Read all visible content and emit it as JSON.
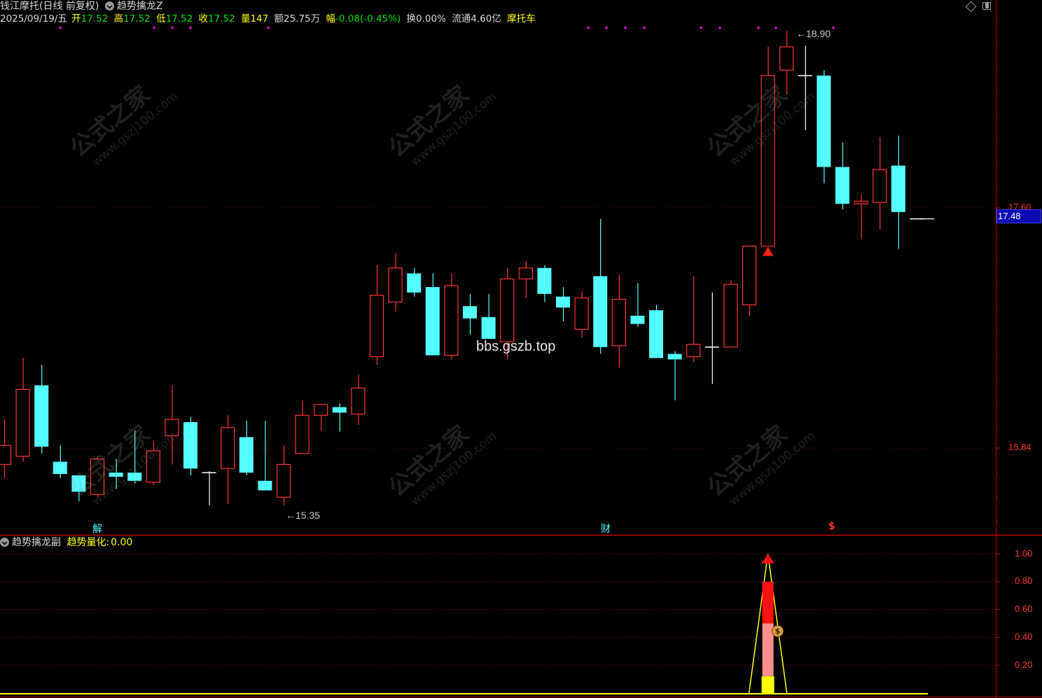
{
  "header": {
    "stock_name": "钱江摩托",
    "period": "(日线 前复权)",
    "indicator": "趋势擒龙Z",
    "date": "2025/09/19/五",
    "open_label": "开",
    "open": "17.52",
    "high_label": "高",
    "high": "17.52",
    "low_label": "低",
    "low": "17.52",
    "close_label": "收",
    "close": "17.52",
    "vol_label": "量",
    "vol": "147",
    "amount_label": "额",
    "amount": "25.75万",
    "change_label": "幅",
    "change": "-0.08(-0.45%)",
    "turnover_label": "换",
    "turnover": "0.00%",
    "float_label": "流通",
    "float_cap": "4.60亿",
    "sector": "摩托车"
  },
  "sub_header": {
    "panel_name": "趋势擒龙副",
    "series_label": "趋势量化:",
    "series_value": "0.00"
  },
  "annotations": {
    "high_marker": "18.90",
    "low_marker": "15.35",
    "signal_1": "解",
    "signal_2": "财",
    "signal_3": "$",
    "coin": "$",
    "watermark_site": "bbs.gszb.top",
    "watermark_logo": "公式之家",
    "watermark_url": "www.gszj100.com"
  },
  "price_axis": {
    "ticks": [
      "17.60",
      "15.84"
    ],
    "current_price": "17.48"
  },
  "sub_axis": {
    "ticks": [
      "1.00",
      "0.80",
      "0.60",
      "0.40",
      "0.20"
    ]
  },
  "toolbar": {
    "diamond_icon": "diamond-icon",
    "window_icon": "window-icon"
  },
  "colors": {
    "up": "#ff3232",
    "down": "#54ffff",
    "flat": "#ffffff",
    "axis": "#c00000",
    "yellow": "#ffff00",
    "magenta": "#ff00ff"
  },
  "chart_data": [
    {
      "type": "candlestick",
      "title": "钱江摩托(日线 前复权)",
      "ylim": [
        14.9,
        19.1
      ],
      "candles": [
        {
          "o": 15.72,
          "h": 16.05,
          "l": 15.62,
          "c": 15.86
        },
        {
          "o": 15.78,
          "h": 16.5,
          "l": 15.74,
          "c": 16.27
        },
        {
          "o": 16.3,
          "h": 16.45,
          "l": 15.8,
          "c": 15.85
        },
        {
          "o": 15.74,
          "h": 15.86,
          "l": 15.62,
          "c": 15.65
        },
        {
          "o": 15.64,
          "h": 15.63,
          "l": 15.45,
          "c": 15.52
        },
        {
          "o": 15.5,
          "h": 15.78,
          "l": 15.48,
          "c": 15.76
        },
        {
          "o": 15.66,
          "h": 15.76,
          "l": 15.54,
          "c": 15.63
        },
        {
          "o": 15.66,
          "h": 15.97,
          "l": 15.58,
          "c": 15.6
        },
        {
          "o": 15.59,
          "h": 15.89,
          "l": 15.57,
          "c": 15.82
        },
        {
          "o": 15.93,
          "h": 16.3,
          "l": 15.72,
          "c": 16.05
        },
        {
          "o": 16.03,
          "h": 16.07,
          "l": 15.64,
          "c": 15.69
        },
        {
          "o": 15.66,
          "h": 15.67,
          "l": 15.42,
          "c": 15.66
        },
        {
          "o": 15.69,
          "h": 16.08,
          "l": 15.43,
          "c": 15.99
        },
        {
          "o": 15.92,
          "h": 16.04,
          "l": 15.64,
          "c": 15.66
        },
        {
          "o": 15.6,
          "h": 16.04,
          "l": 15.58,
          "c": 15.53
        },
        {
          "o": 15.48,
          "h": 15.86,
          "l": 15.42,
          "c": 15.72
        },
        {
          "o": 15.8,
          "h": 16.19,
          "l": 15.81,
          "c": 16.08
        },
        {
          "o": 16.08,
          "h": 16.15,
          "l": 15.97,
          "c": 16.16
        },
        {
          "o": 16.14,
          "h": 16.17,
          "l": 15.96,
          "c": 16.1
        },
        {
          "o": 16.09,
          "h": 16.38,
          "l": 16.01,
          "c": 16.28
        },
        {
          "o": 16.51,
          "h": 17.18,
          "l": 16.45,
          "c": 16.96
        },
        {
          "o": 16.91,
          "h": 17.27,
          "l": 16.84,
          "c": 17.16
        },
        {
          "o": 17.12,
          "h": 17.16,
          "l": 16.95,
          "c": 16.98
        },
        {
          "o": 17.02,
          "h": 17.12,
          "l": 16.52,
          "c": 16.52
        },
        {
          "o": 16.52,
          "h": 17.12,
          "l": 16.49,
          "c": 17.03
        },
        {
          "o": 16.88,
          "h": 16.97,
          "l": 16.67,
          "c": 16.79
        },
        {
          "o": 16.8,
          "h": 16.97,
          "l": 16.69,
          "c": 16.64
        },
        {
          "o": 16.62,
          "h": 17.16,
          "l": 16.49,
          "c": 17.08
        },
        {
          "o": 17.08,
          "h": 17.21,
          "l": 16.94,
          "c": 17.16
        },
        {
          "o": 17.16,
          "h": 17.18,
          "l": 16.91,
          "c": 16.97
        },
        {
          "o": 16.95,
          "h": 17.02,
          "l": 16.77,
          "c": 16.87
        },
        {
          "o": 16.71,
          "h": 16.99,
          "l": 16.65,
          "c": 16.94
        },
        {
          "o": 17.1,
          "h": 17.52,
          "l": 16.53,
          "c": 16.58
        },
        {
          "o": 16.59,
          "h": 17.11,
          "l": 16.43,
          "c": 16.93
        },
        {
          "o": 16.81,
          "h": 17.05,
          "l": 16.73,
          "c": 16.75
        },
        {
          "o": 16.85,
          "h": 16.89,
          "l": 16.51,
          "c": 16.5
        },
        {
          "o": 16.53,
          "h": 16.55,
          "l": 16.19,
          "c": 16.49
        },
        {
          "o": 16.51,
          "h": 17.1,
          "l": 16.47,
          "c": 16.6
        },
        {
          "o": 16.58,
          "h": 16.98,
          "l": 16.31,
          "c": 16.58
        },
        {
          "o": 16.58,
          "h": 17.07,
          "l": 16.58,
          "c": 17.04
        },
        {
          "o": 16.89,
          "h": 17.32,
          "l": 16.81,
          "c": 17.32
        },
        {
          "o": 17.32,
          "h": 18.78,
          "l": 17.32,
          "c": 18.57
        },
        {
          "o": 18.61,
          "h": 18.9,
          "l": 18.43,
          "c": 18.78
        },
        {
          "o": 18.57,
          "h": 18.79,
          "l": 18.17,
          "c": 18.57
        },
        {
          "o": 18.57,
          "h": 18.61,
          "l": 17.78,
          "c": 17.9
        },
        {
          "o": 17.9,
          "h": 18.08,
          "l": 17.59,
          "c": 17.63
        },
        {
          "o": 17.63,
          "h": 17.7,
          "l": 17.37,
          "c": 17.65
        },
        {
          "o": 17.64,
          "h": 18.12,
          "l": 17.44,
          "c": 17.88
        },
        {
          "o": 17.91,
          "h": 18.13,
          "l": 17.3,
          "c": 17.57
        },
        {
          "o": 17.52,
          "h": 17.52,
          "l": 17.52,
          "c": 17.52
        }
      ]
    },
    {
      "type": "area",
      "title": "趋势擒龙副",
      "series": [
        {
          "name": "趋势量化",
          "values": [
            0,
            0,
            0,
            0,
            0,
            0,
            0,
            0,
            0,
            0,
            0,
            0,
            0,
            0,
            0,
            0,
            0,
            0,
            0,
            0,
            0,
            0,
            0,
            0,
            0,
            0,
            0,
            0,
            0,
            0,
            0,
            0,
            0,
            0,
            0,
            0,
            0,
            0,
            0,
            0,
            0,
            1.0,
            0,
            0,
            0,
            0,
            0,
            0,
            0,
            0
          ]
        }
      ],
      "ylim": [
        0,
        1.05
      ]
    }
  ]
}
